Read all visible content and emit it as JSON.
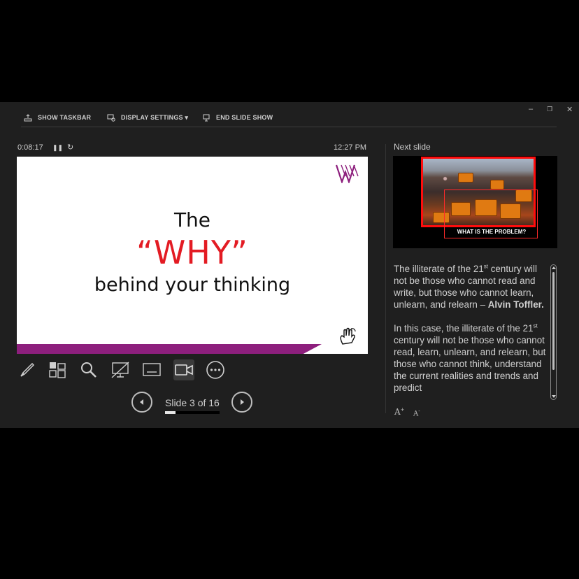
{
  "window": {
    "minimize": "–",
    "restore": "❐",
    "close": "✕"
  },
  "toolbar": {
    "show_taskbar": "SHOW TASKBAR",
    "display_settings": "DISPLAY SETTINGS ▾",
    "end_slide_show": "END SLIDE SHOW"
  },
  "timer": {
    "elapsed": "0:08:17",
    "pause": "❚❚",
    "reset": "↻",
    "clock": "12:27 PM"
  },
  "current_slide": {
    "line1": "The",
    "line2": "“WHY”",
    "line3": "behind your thinking",
    "band_color": "#8d1f7d",
    "accent": "#e31b23"
  },
  "navigation": {
    "counter": "Slide 3 of 16",
    "progress": 0.1875
  },
  "next_slide": {
    "label": "Next slide",
    "caption": "WHAT IS THE PROBLEM?"
  },
  "notes": {
    "p1_a": "The illiterate of the 21",
    "p1_sup": "st",
    "p1_b": " century will not be those who cannot read and write, but those who cannot learn, unlearn, and relearn – ",
    "p1_bold": "Alvin Toffler.",
    "p2_a": "In this case, the illiterate of the 21",
    "p2_sup": "st",
    "p2_b": " century will not be those who cannot read, learn, unlearn, and relearn, but those who cannot think, understand the current realities and trends and predict"
  },
  "font_controls": {
    "increase": "A",
    "decrease": "A"
  }
}
